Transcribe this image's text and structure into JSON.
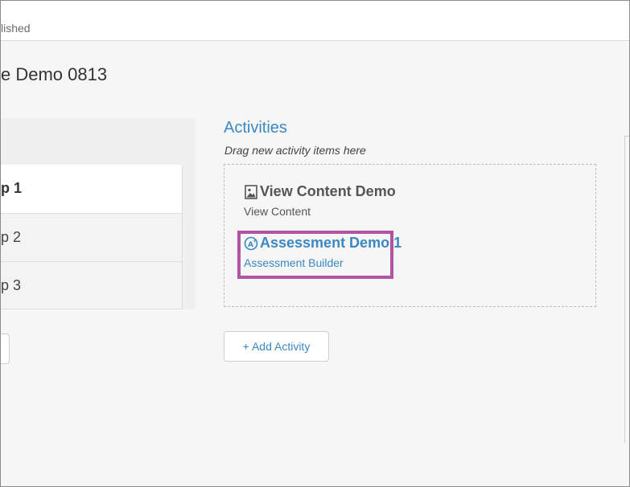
{
  "header": {
    "status_text": "lished"
  },
  "page": {
    "title": "e Demo 0813"
  },
  "steps": [
    {
      "label": "p 1",
      "active": true
    },
    {
      "label": "p 2",
      "active": false
    },
    {
      "label": "p 3",
      "active": false
    }
  ],
  "activities": {
    "title": "Activities",
    "hint": "Drag new activity items here",
    "items": [
      {
        "title": "View Content Demo",
        "subtitle": "View Content",
        "icon": "image-icon"
      },
      {
        "title": "Assessment Demo 1",
        "subtitle": "Assessment Builder",
        "icon": "assessment-icon"
      }
    ],
    "add_button_label": "+ Add Activity"
  },
  "colors": {
    "accent": "#3b88c3",
    "highlight": "#b254a3",
    "background": "#f6f6f7"
  }
}
